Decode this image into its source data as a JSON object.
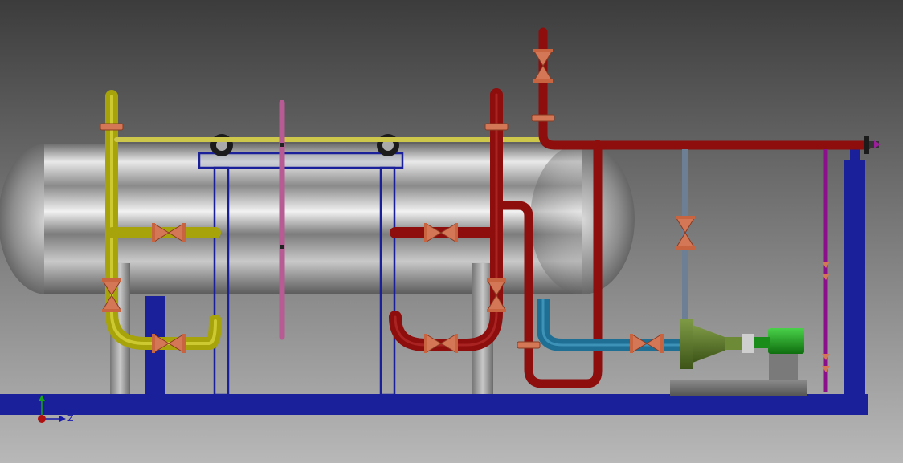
{
  "viewport": {
    "background_top": "#3c3c3c",
    "background_bottom": "#b8b8b8"
  },
  "colors": {
    "skid_frame": "#1a1f9a",
    "vessel_steel": "#b5b5b5",
    "yellow_line": "#a7a30b",
    "red_line": "#8e0d0d",
    "pink_line": "#b85a93",
    "blue_line": "#1f6f95",
    "grey_line": "#6d7f95",
    "purple_line": "#8b0f8b",
    "valve_flange": "#d47756",
    "pump_casing": "#5c7a2e",
    "motor": "#1fa31f",
    "handwheel": "#1b1b1b"
  },
  "orientation_triad": {
    "y_axis_color": "#19a319",
    "z_axis_color": "#1a1aa8",
    "origin_color": "#b01010",
    "z_label": "Z"
  },
  "icons": [
    "handwheel-icon",
    "handwheel-icon",
    "triad-icon"
  ]
}
